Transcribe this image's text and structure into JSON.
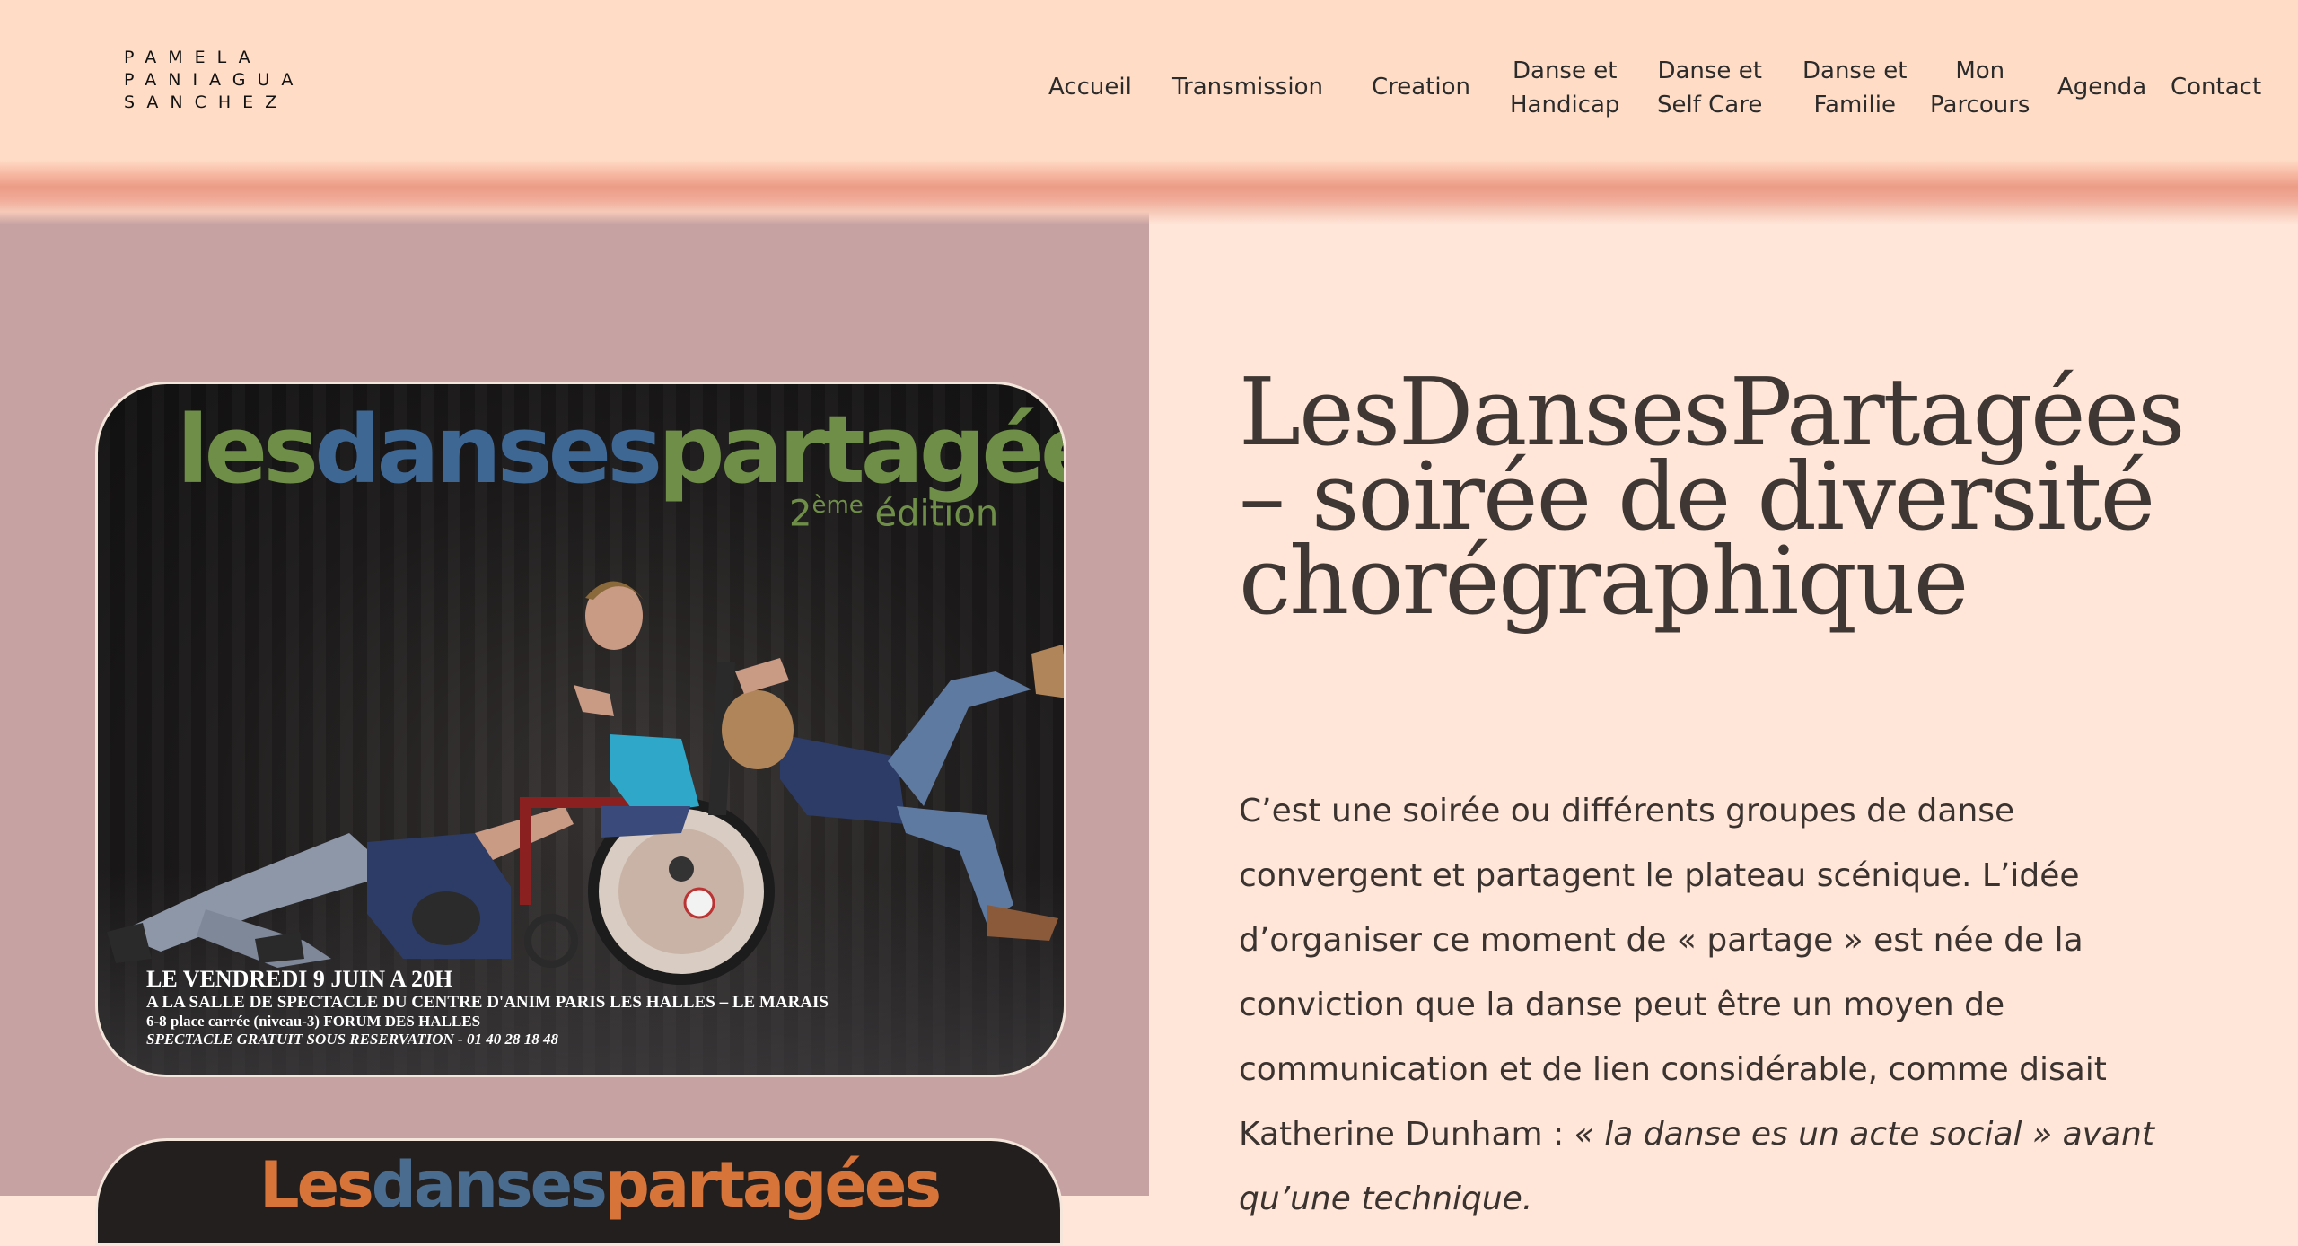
{
  "header": {
    "logo_lines": [
      "PAMELA",
      "PANIAGUA",
      "SANCHEZ"
    ],
    "nav": [
      {
        "lines": [
          "Accueil"
        ]
      },
      {
        "lines": [
          "Transmission"
        ]
      },
      {
        "lines": [
          "Creation"
        ]
      },
      {
        "lines": [
          "Danse et",
          "Handicap"
        ]
      },
      {
        "lines": [
          "Danse et",
          "Self Care"
        ]
      },
      {
        "lines": [
          "Danse et",
          "Familie"
        ]
      },
      {
        "lines": [
          "Mon",
          "Parcours"
        ]
      },
      {
        "lines": [
          "Agenda"
        ]
      },
      {
        "lines": [
          "Contact"
        ]
      }
    ]
  },
  "poster": {
    "title_parts": [
      "les",
      "danses",
      "partagées"
    ],
    "edition_number": "2",
    "edition_sup": "ème",
    "edition_word": "édition",
    "info": [
      "LE VENDREDI 9 JUIN A 20H",
      "A LA SALLE DE SPECTACLE DU CENTRE D'ANIM PARIS LES HALLES – LE MARAIS",
      "6-8 place carrée (niveau-3) FORUM DES HALLES",
      "SPECTACLE GRATUIT SOUS RESERVATION   - 01 40 28 18 48"
    ]
  },
  "poster2": {
    "title_parts": [
      "Les",
      "danses",
      "partagées"
    ]
  },
  "article": {
    "title": "LesDansesPartagées – soirée de diversité chorégraphique",
    "body_plain": "C’est une soirée ou différents groupes de danse convergent et partagent le plateau scénique. L’idée d’organiser ce moment de « partage » est née de la conviction que la danse peut être un moyen de communication et de lien considérable, comme disait Katherine Dunham : ",
    "body_quote": "« la danse es un acte social » avant qu’une technique."
  },
  "colors": {
    "header_bg": "#ffdcc6",
    "left_panel_bg": "#c6a2a2",
    "right_panel_bg": "#ffe6d8",
    "title_text": "#3e3734",
    "poster_green": "#6f8f48",
    "poster_blue": "#3f6794"
  }
}
